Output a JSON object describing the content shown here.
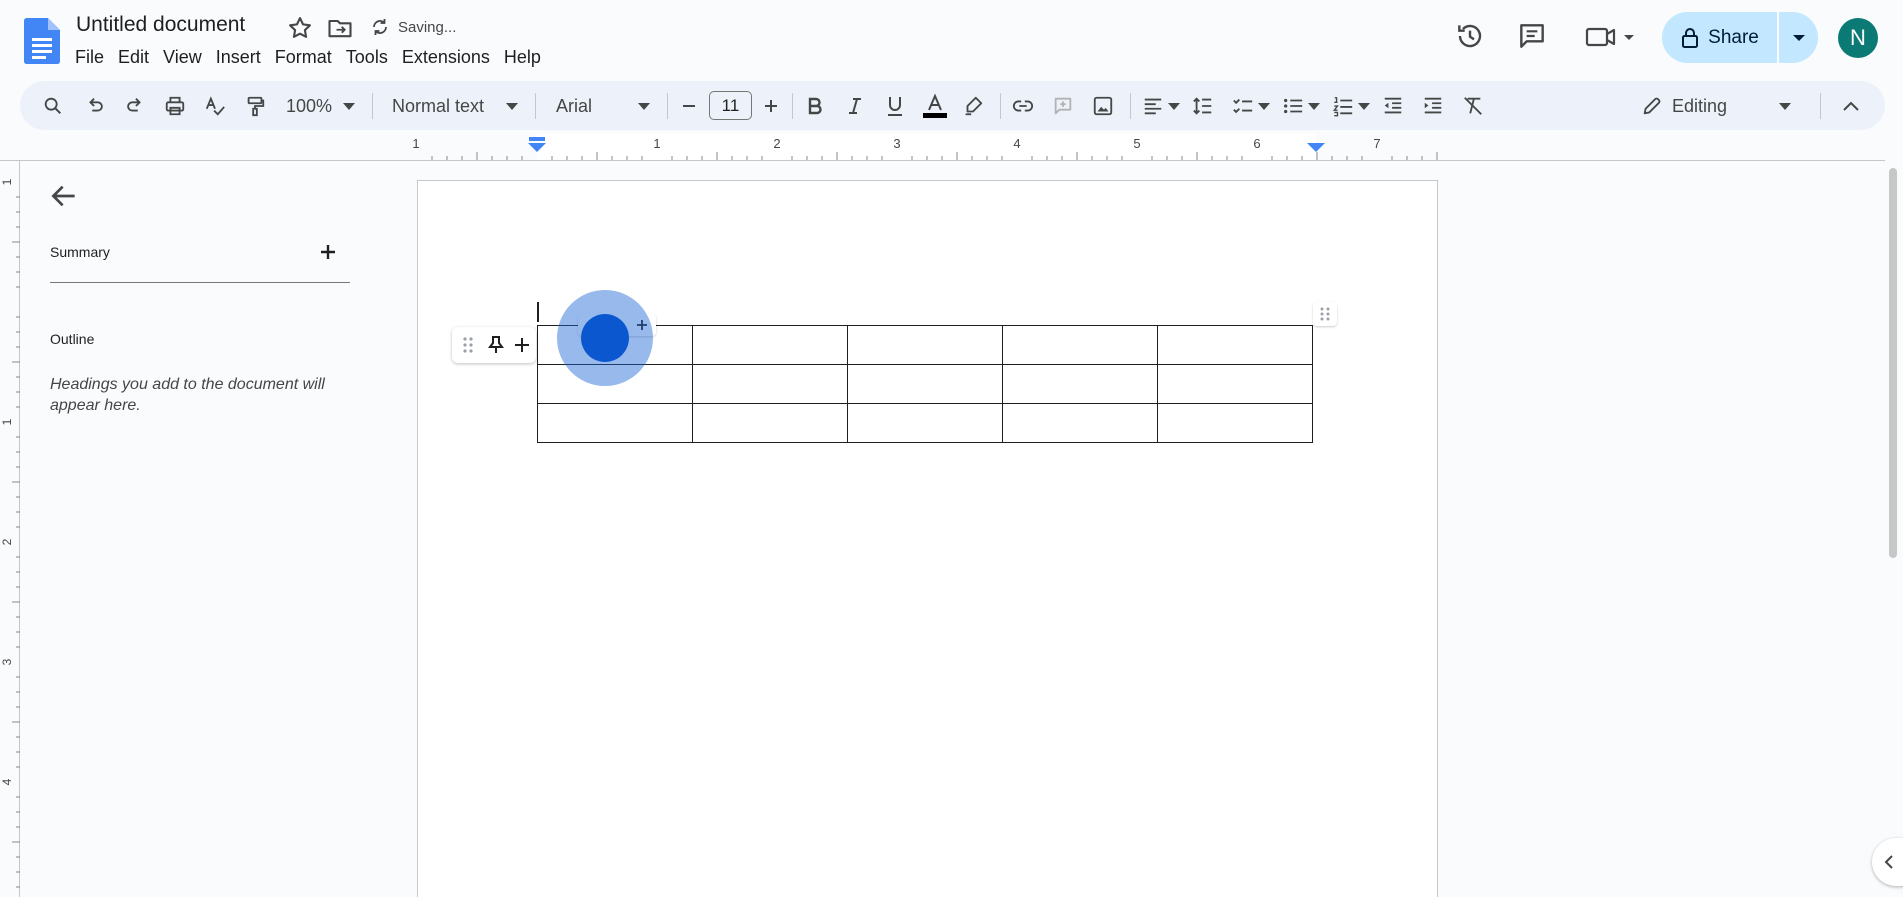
{
  "app": {
    "title": "Untitled document",
    "save_status": "Saving...",
    "menu": [
      "File",
      "Edit",
      "View",
      "Insert",
      "Format",
      "Tools",
      "Extensions",
      "Help"
    ],
    "share_label": "Share",
    "avatar_initial": "N",
    "brand_color": "#4285f4",
    "avatar_color": "#0b7a75",
    "share_bg": "#c2e7ff"
  },
  "toolbar": {
    "zoom": "100%",
    "style": "Normal text",
    "font": "Arial",
    "font_size": "11",
    "mode": "Editing",
    "text_color": "#000000"
  },
  "ruler": {
    "h_labels": [
      "1",
      "1",
      "2",
      "3",
      "4",
      "5",
      "6",
      "7"
    ],
    "v_labels": [
      "1",
      "1",
      "2",
      "3",
      "4"
    ]
  },
  "sidebar": {
    "summary_label": "Summary",
    "outline_label": "Outline",
    "outline_hint": "Headings you add to the document will appear here."
  },
  "document": {
    "table": {
      "rows": 3,
      "cols": 5,
      "cells": [
        [
          "",
          "",
          "",
          "",
          ""
        ],
        [
          "",
          "",
          "",
          "",
          ""
        ],
        [
          "",
          "",
          "",
          "",
          ""
        ]
      ]
    }
  },
  "icons": {
    "search": "search-icon",
    "undo": "undo-icon",
    "redo": "redo-icon",
    "print": "print-icon",
    "spellcheck": "spellcheck-icon",
    "paint_format": "paint-format-icon",
    "bold": "bold-icon",
    "italic": "italic-icon",
    "underline": "underline-icon",
    "highlight": "highlight-icon",
    "link": "link-icon",
    "comment": "add-comment-icon",
    "image": "image-icon",
    "align": "align-left-icon",
    "line_spacing": "line-spacing-icon",
    "checklist": "checklist-icon",
    "bullets": "bulleted-list-icon",
    "numbered": "numbered-list-icon",
    "indent_dec": "decrease-indent-icon",
    "indent_inc": "increase-indent-icon",
    "clear_format": "clear-formatting-icon",
    "pencil": "pencil-icon",
    "history": "history-icon",
    "comments": "comments-icon",
    "meet": "video-call-icon",
    "lock": "lock-icon"
  }
}
